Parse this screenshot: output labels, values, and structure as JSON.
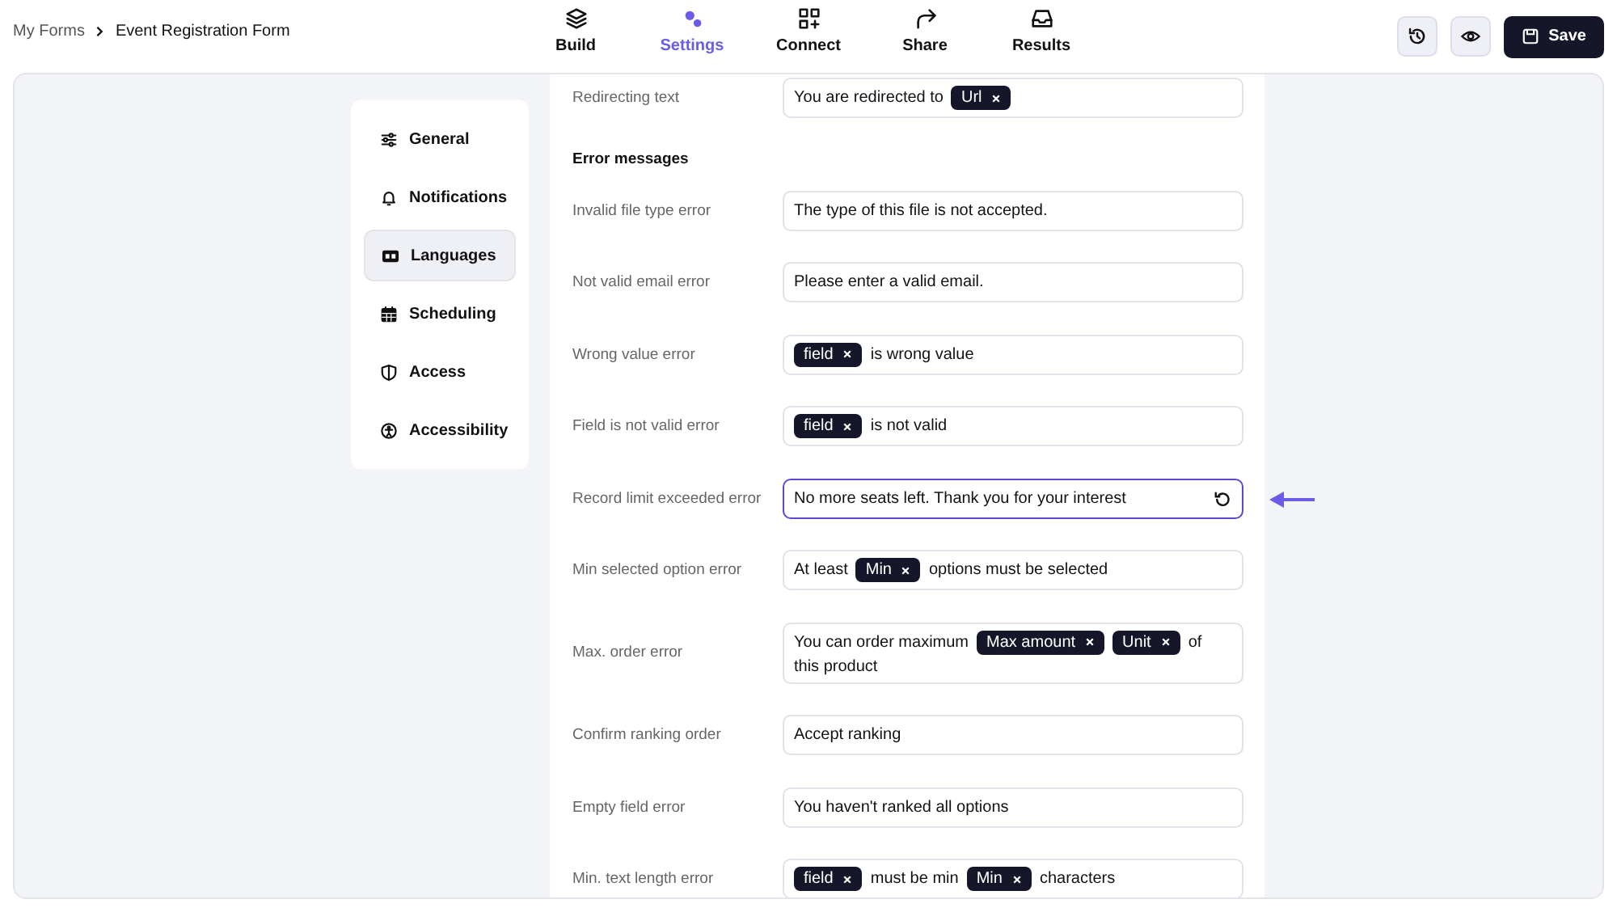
{
  "breadcrumb": {
    "parent": "My Forms",
    "current": "Event Registration Form"
  },
  "tabs": [
    {
      "label": "Build",
      "selected": false
    },
    {
      "label": "Settings",
      "selected": true
    },
    {
      "label": "Connect",
      "selected": false
    },
    {
      "label": "Share",
      "selected": false
    },
    {
      "label": "Results",
      "selected": false
    }
  ],
  "actions": {
    "save": "Save"
  },
  "sidebar": {
    "items": [
      {
        "label": "General",
        "selected": false
      },
      {
        "label": "Notifications",
        "selected": false
      },
      {
        "label": "Languages",
        "selected": true
      },
      {
        "label": "Scheduling",
        "selected": false
      },
      {
        "label": "Access",
        "selected": false
      },
      {
        "label": "Accessibility",
        "selected": false
      }
    ]
  },
  "rows": [
    {
      "kind": "field",
      "label": "Redirecting text",
      "focused": false,
      "parts": [
        {
          "kind": "text",
          "text": "You are redirected to"
        },
        {
          "kind": "token",
          "text": "Url"
        }
      ]
    },
    {
      "kind": "heading",
      "label": "Error messages"
    },
    {
      "kind": "field",
      "label": "Invalid file type error",
      "focused": false,
      "parts": [
        {
          "kind": "text",
          "text": "The type of this file is not accepted."
        }
      ]
    },
    {
      "kind": "field",
      "label": "Not valid email error",
      "focused": false,
      "parts": [
        {
          "kind": "text",
          "text": "Please enter a valid email."
        }
      ]
    },
    {
      "kind": "field",
      "label": "Wrong value error",
      "focused": false,
      "parts": [
        {
          "kind": "token",
          "text": "field"
        },
        {
          "kind": "text",
          "text": "is wrong value"
        }
      ]
    },
    {
      "kind": "field",
      "label": "Field is not valid error",
      "focused": false,
      "parts": [
        {
          "kind": "token",
          "text": "field"
        },
        {
          "kind": "text",
          "text": "is not valid"
        }
      ]
    },
    {
      "kind": "field",
      "label": "Record limit exceeded error",
      "focused": true,
      "parts": [
        {
          "kind": "text",
          "text": "No more seats left. Thank you for your interest"
        }
      ]
    },
    {
      "kind": "field",
      "label": "Min selected option error",
      "focused": false,
      "parts": [
        {
          "kind": "text",
          "text": "At least"
        },
        {
          "kind": "token",
          "text": "Min"
        },
        {
          "kind": "text",
          "text": "options must be selected"
        }
      ]
    },
    {
      "kind": "field",
      "label": "Max. order error",
      "focused": false,
      "parts": [
        {
          "kind": "text",
          "text": "You can order maximum"
        },
        {
          "kind": "token",
          "text": "Max amount"
        },
        {
          "kind": "token",
          "text": "Unit"
        },
        {
          "kind": "text",
          "text": "of"
        },
        {
          "kind": "text",
          "text": "this product"
        }
      ]
    },
    {
      "kind": "field",
      "label": "Confirm ranking order",
      "focused": false,
      "parts": [
        {
          "kind": "text",
          "text": "Accept ranking"
        }
      ]
    },
    {
      "kind": "field",
      "label": "Empty field error",
      "focused": false,
      "parts": [
        {
          "kind": "text",
          "text": "You haven't ranked all options"
        }
      ]
    },
    {
      "kind": "field",
      "label": "Min. text length error",
      "focused": false,
      "parts": [
        {
          "kind": "token",
          "text": "field"
        },
        {
          "kind": "text",
          "text": "must be min"
        },
        {
          "kind": "token",
          "text": "Min"
        },
        {
          "kind": "text",
          "text": "characters"
        }
      ]
    }
  ]
}
